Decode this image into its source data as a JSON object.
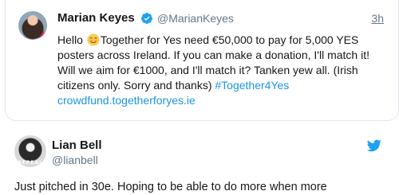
{
  "quoted_tweet": {
    "author_name": "Marian Keyes",
    "handle": "@MarianKeyes",
    "time": "3h",
    "text_before_emoji": "Hello ",
    "text_after_emoji": "Together for Yes need €50,000 to pay for 5,000 YES posters across Ireland. If you can make a donation, I'll match it! Will we aim for €1000, and I'll match it? Tanken yew all. (Irish citizens only. Sorry and thanks) ",
    "hashtag": "#Together4Yes",
    "link": "crowdfund.togetherforyes.ie",
    "emoji": "smiling-face-icon"
  },
  "tweet": {
    "author_name": "Lian Bell",
    "handle": "@lianbell",
    "avatar_text": "REPEAL",
    "text": "Just pitched in 30e. Hoping to be able to do more when more"
  },
  "colors": {
    "link": "#1b95e0",
    "text": "#14171a",
    "muted": "#657786",
    "border": "#e1e8ed",
    "verified": "#1da1f2",
    "twitter_bird": "#1da1f2"
  }
}
